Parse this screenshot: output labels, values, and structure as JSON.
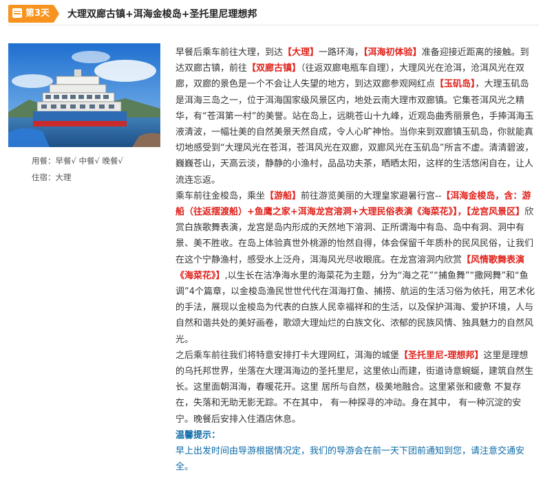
{
  "day": {
    "badge": "第3天",
    "title": "大理双廊古镇+洱海金梭岛+圣托里尼理想邦"
  },
  "sidebar": {
    "meals": "用餐：早餐√  中餐√  晚餐√",
    "stay": "住宿：大理"
  },
  "paragraphs": {
    "p1": {
      "s1": "早餐后乘车前往大理，到达",
      "r1": "【大理】",
      "s2": "一路环海，",
      "r2": "【洱海初体验】",
      "s3": "准备迎接近距离的接触。到达双廊古镇，前往",
      "r3": "【双廊古镇】",
      "s4": "（往返双廊电瓶车自理），大理风光在沧洱，沧洱风光在双廊，双廊的景色是一个不会让人失望的地方，到达双廊参观网红点",
      "r4": "【玉矶岛】",
      "s5": "，大理玉矶岛是洱海三岛之一，位于洱海国家级风景区内，地处云南大理市双廊镇。它集苍洱风光之精华，有“苍洱第一村”的美誉。站在岛上，远眺苍山十九峰，近观岛曲秀丽景色，手捧洱海玉液清波，一幅壮美的自然美景天然自成，令人心旷神怡。当你来到双廊镇玉矶岛，你就能真切地感受到“大理风光在苍洱，苍洱风光在双廊，双廊风光在玉矶岛”所言不虚。清清碧波，巍巍苍山，天高云淡，静静的小渔村，品品功夫茶，晒晒太阳，这样的生活悠闲自在，让人流连忘返。"
    },
    "p2": {
      "s1": "乘车前往金梭岛，乘坐",
      "r1": "【游船】",
      "s2": "前往游览美丽的大理皇家避暑行宫--",
      "r2": "【洱海金梭岛，含：游船（往返摆渡船）+鱼鹰之家+洱海龙宫溶洞+大理民俗表演《海菜花》】，【龙宫风景区】",
      "s3": "欣赏白族歌舞表演，龙宫是岛内形成的天然地下溶洞、正所谓海中有岛、岛中有洞、洞中有景、美不胜收。在岛上体验真世外桃源的怡然自得，体会保留千年质朴的民风民俗，让我们在这个宁静渔村，感受水上泛舟，洱海风光尽收眼底。在龙宫溶洞内欣赏",
      "r3": "【风情歌舞表演《海菜花》】",
      "s4": ",以生长在洁净海水里的海菜花为主题，分为“海之花”“捕鱼舞”“撒网舞”和“鱼调”4个篇章，以金梭岛渔民世世代代在洱海打鱼、捕捞、航运的生活习俗为依托，用艺术化的手法，展现以金梭岛为代表的白族人民幸福祥和的生活，以及保护洱海、爱护环境，人与自然和谐共处的美好画卷，歌颂大理灿烂的白族文化、浓郁的民族风情、独具魅力的自然风光。"
    },
    "p3": {
      "s1": "之后乘车前往我们将特意安排打卡大理网红，洱海的城堡",
      "r1": "【圣托里尼-理想邦】",
      "s2": "这里是理想的乌托邦世界，坐落在大理洱海边的圣托里尼，这里依山而建，街道诗意蜿蜒，建筑自然生长。这里面朝洱海，春暖花开。这里 居所与自然，极美地融合。这里紧张和疲惫 不复存在，失落和无助无影无踪。不在其中， 有一种探寻的冲动。身在其中， 有一种沉淀的安宁。晚餐后安排入住酒店休息。"
    }
  },
  "tips": {
    "title": "温馨提示：",
    "text": "早上出发时间由导游根据情况定，我们的导游会在前一天下团前通知到您，请注意交通安全。"
  },
  "colors": {
    "badge": "#f7931e",
    "highlight": "#e0211b",
    "tip": "#0b6aa8"
  }
}
